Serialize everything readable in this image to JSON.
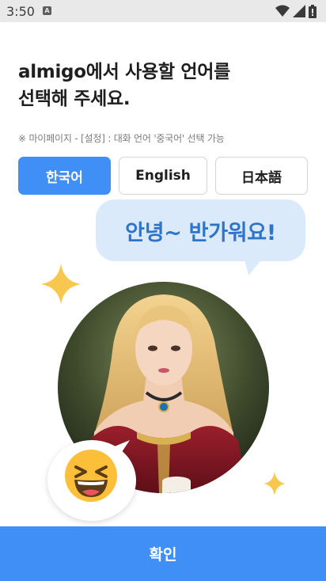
{
  "status_bar": {
    "time": "3:50",
    "app_icon": "A",
    "icons": [
      "wifi-icon",
      "signal-icon",
      "battery-icon"
    ]
  },
  "header": {
    "title": "almigo에서 사용할 언어를\n선택해 주세요.",
    "hint": "※ 마이페이지 - [설정] : 대화 언어 '중국어' 선택 가능"
  },
  "languages": [
    {
      "label": "한국어",
      "selected": true
    },
    {
      "label": "English",
      "selected": false
    },
    {
      "label": "日本語",
      "selected": false
    }
  ],
  "greeting": "안녕~ 반가워요!",
  "avatar": {
    "icon": "character-portrait",
    "emoji": "laughing-emoji-icon"
  },
  "confirm_label": "확인",
  "colors": {
    "accent": "#3f8ff7",
    "bubble_bg": "#dbeafb",
    "bubble_text": "#2e74c9",
    "sparkle": "#f8c84e"
  }
}
